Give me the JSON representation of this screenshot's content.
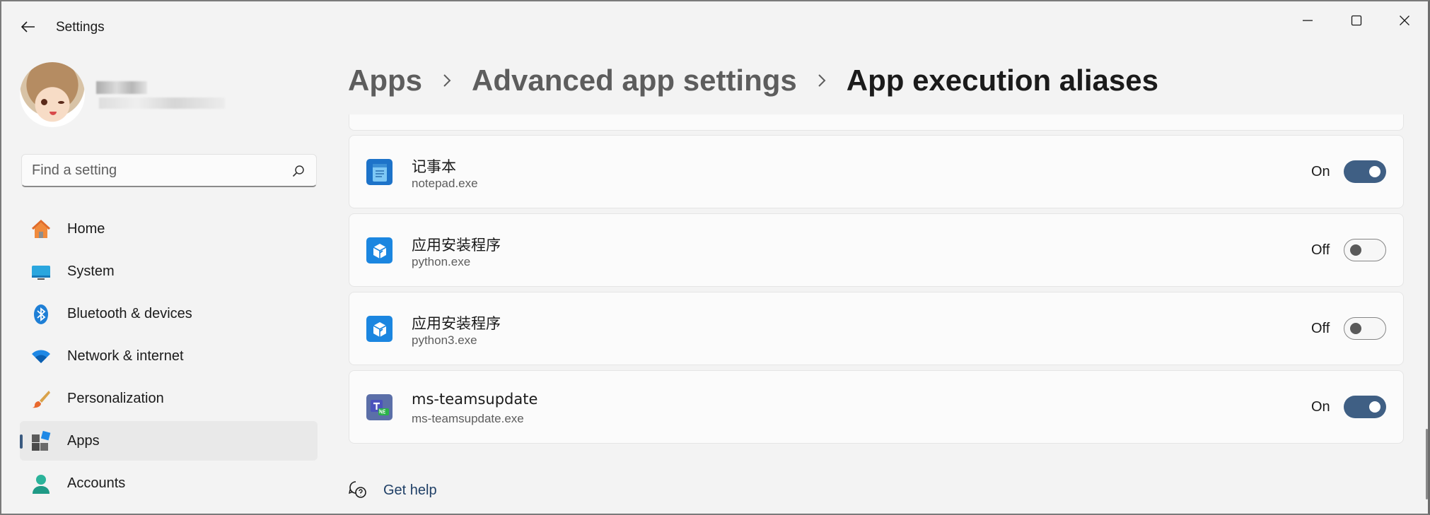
{
  "window": {
    "title": "Settings",
    "controls": {
      "minimize": "minimize-icon",
      "maximize": "maximize-icon",
      "close": "close-icon"
    }
  },
  "search": {
    "placeholder": "Find a setting",
    "value": ""
  },
  "sidebar": {
    "items": [
      {
        "label": "Home",
        "icon": "home-icon",
        "active": false
      },
      {
        "label": "System",
        "icon": "monitor-icon",
        "active": false
      },
      {
        "label": "Bluetooth & devices",
        "icon": "bluetooth-icon",
        "active": false
      },
      {
        "label": "Network & internet",
        "icon": "wifi-icon",
        "active": false
      },
      {
        "label": "Personalization",
        "icon": "brush-icon",
        "active": false
      },
      {
        "label": "Apps",
        "icon": "apps-icon",
        "active": true
      },
      {
        "label": "Accounts",
        "icon": "person-icon",
        "active": false
      }
    ]
  },
  "breadcrumb": {
    "items": [
      "Apps",
      "Advanced app settings"
    ],
    "current": "App execution aliases"
  },
  "aliases": [
    {
      "name": "记事本",
      "exe": "notepad.exe",
      "state": "On",
      "enabled": true,
      "icon": "notepad-icon"
    },
    {
      "name": "应用安装程序",
      "exe": "python.exe",
      "state": "Off",
      "enabled": false,
      "icon": "app-installer-icon"
    },
    {
      "name": "应用安装程序",
      "exe": "python3.exe",
      "state": "Off",
      "enabled": false,
      "icon": "app-installer-icon"
    },
    {
      "name": "ms-teamsupdate",
      "exe": "ms-teamsupdate.exe",
      "state": "On",
      "enabled": true,
      "icon": "teams-icon"
    }
  ],
  "help": {
    "label": "Get help"
  },
  "colors": {
    "accent": "#3f5f84",
    "link": "#1f3f66",
    "background": "#f3f3f3",
    "card": "#fbfbfb"
  }
}
